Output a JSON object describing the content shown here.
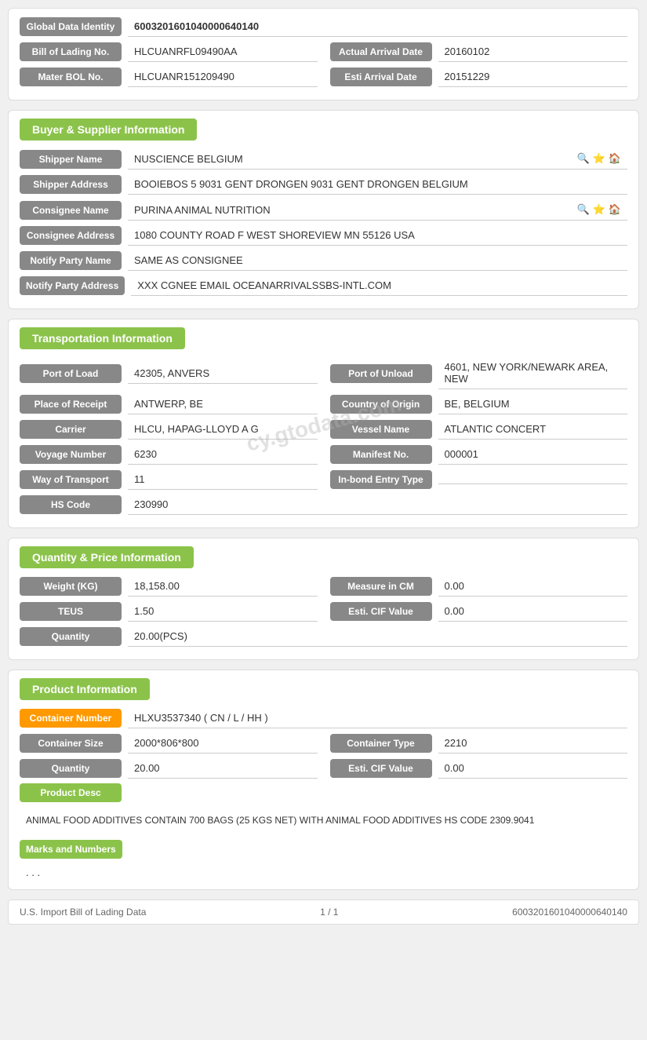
{
  "identity": {
    "label": "Global Data Identity",
    "value": "6003201601040000640140"
  },
  "bill": {
    "label": "Bill of Lading No.",
    "value": "HLCUANRFL09490AA",
    "actual_arrival_label": "Actual Arrival Date",
    "actual_arrival_value": "20160102"
  },
  "master_bol": {
    "label": "Mater BOL No.",
    "value": "HLCUANR151209490",
    "esti_arrival_label": "Esti Arrival Date",
    "esti_arrival_value": "20151229"
  },
  "buyer_supplier": {
    "section_title": "Buyer & Supplier Information",
    "shipper_name_label": "Shipper Name",
    "shipper_name_value": "NUSCIENCE BELGIUM",
    "shipper_address_label": "Shipper Address",
    "shipper_address_value": "BOOIEBOS 5 9031 GENT DRONGEN 9031 GENT DRONGEN BELGIUM",
    "consignee_name_label": "Consignee Name",
    "consignee_name_value": "PURINA ANIMAL NUTRITION",
    "consignee_address_label": "Consignee Address",
    "consignee_address_value": "1080 COUNTY ROAD F WEST SHOREVIEW MN 55126 USA",
    "notify_party_name_label": "Notify Party Name",
    "notify_party_name_value": "SAME AS CONSIGNEE",
    "notify_party_address_label": "Notify Party Address",
    "notify_party_address_value": "XXX CGNEE EMAIL OCEANARRIVALSSBS-INTL.COM"
  },
  "transportation": {
    "section_title": "Transportation Information",
    "port_of_load_label": "Port of Load",
    "port_of_load_value": "42305, ANVERS",
    "port_of_unload_label": "Port of Unload",
    "port_of_unload_value": "4601, NEW YORK/NEWARK AREA, NEW",
    "place_of_receipt_label": "Place of Receipt",
    "place_of_receipt_value": "ANTWERP, BE",
    "country_of_origin_label": "Country of Origin",
    "country_of_origin_value": "BE, BELGIUM",
    "carrier_label": "Carrier",
    "carrier_value": "HLCU, HAPAG-LLOYD A G",
    "vessel_name_label": "Vessel Name",
    "vessel_name_value": "ATLANTIC CONCERT",
    "voyage_number_label": "Voyage Number",
    "voyage_number_value": "6230",
    "manifest_no_label": "Manifest No.",
    "manifest_no_value": "000001",
    "way_of_transport_label": "Way of Transport",
    "way_of_transport_value": "11",
    "in_bond_entry_label": "In-bond Entry Type",
    "in_bond_entry_value": "",
    "hs_code_label": "HS Code",
    "hs_code_value": "230990",
    "watermark": "cy.gtodata.com"
  },
  "quantity_price": {
    "section_title": "Quantity & Price Information",
    "weight_label": "Weight (KG)",
    "weight_value": "18,158.00",
    "measure_label": "Measure in CM",
    "measure_value": "0.00",
    "teus_label": "TEUS",
    "teus_value": "1.50",
    "esti_cif_label": "Esti. CIF Value",
    "esti_cif_value": "0.00",
    "quantity_label": "Quantity",
    "quantity_value": "20.00(PCS)"
  },
  "product": {
    "section_title": "Product Information",
    "container_number_label": "Container Number",
    "container_number_value": "HLXU3537340 ( CN / L / HH )",
    "container_size_label": "Container Size",
    "container_size_value": "2000*806*800",
    "container_type_label": "Container Type",
    "container_type_value": "2210",
    "quantity_label": "Quantity",
    "quantity_value": "20.00",
    "esti_cif_label": "Esti. CIF Value",
    "esti_cif_value": "0.00",
    "product_desc_label": "Product Desc",
    "product_desc_value": "ANIMAL FOOD ADDITIVES CONTAIN 700 BAGS (25 KGS NET) WITH ANIMAL FOOD ADDITIVES HS CODE 2309.9041",
    "marks_label": "Marks and Numbers",
    "marks_value": ". . ."
  },
  "footer": {
    "left": "U.S. Import Bill of Lading Data",
    "center": "1 / 1",
    "right": "6003201601040000640140"
  },
  "icons": {
    "search": "🔍",
    "star": "⭐",
    "home": "🏠"
  }
}
